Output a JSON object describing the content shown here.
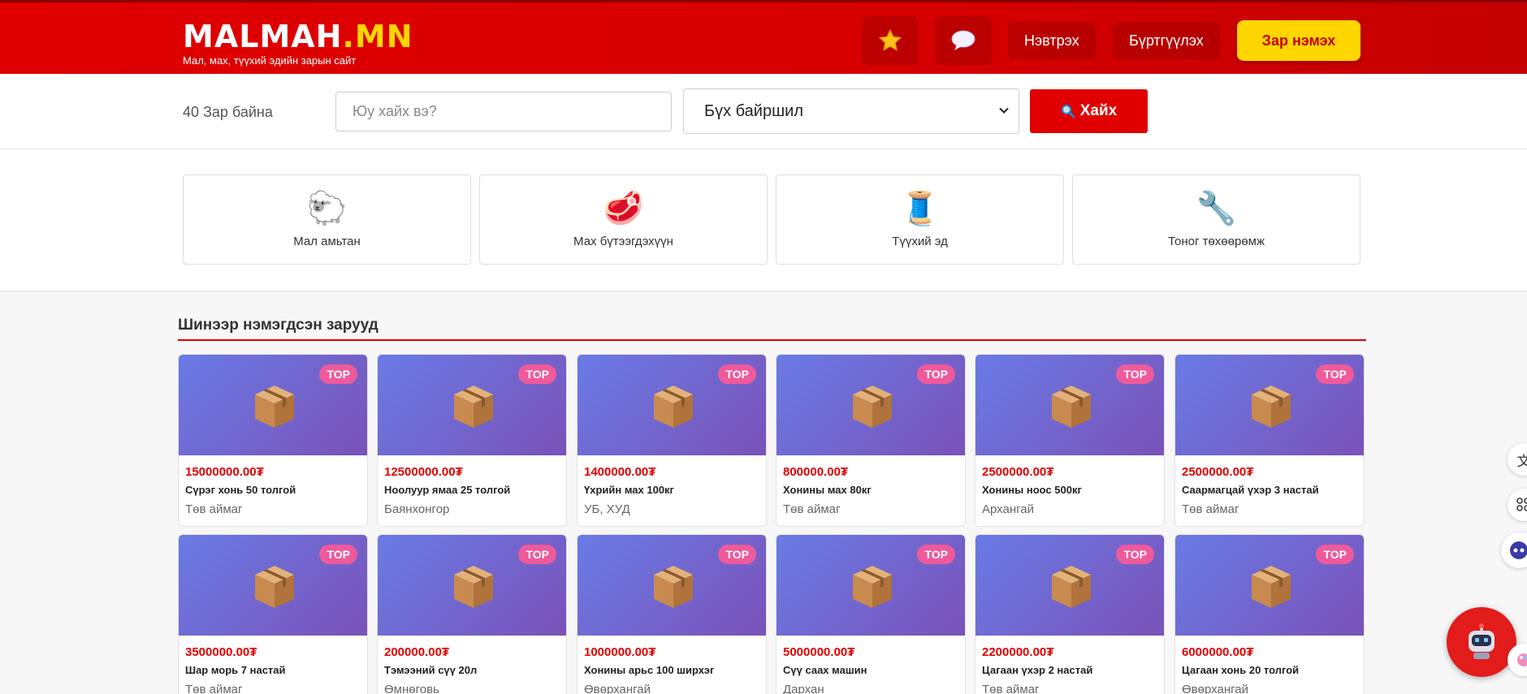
{
  "header": {
    "logo_main": "MALMAH",
    "logo_tld": ".MN",
    "tagline": "Мал, мах, түүхий эдийн зарын сайт",
    "favorites_icon": "star-icon",
    "messages_icon": "chat-bubble-icon",
    "login_label": "Нэвтрэх",
    "register_label": "Бүртгүүлэх",
    "add_ad_label": "Зар нэмэх",
    "colors": {
      "brand_red": "#e00000",
      "accent_yellow": "#ffd600"
    }
  },
  "search": {
    "ad_count": "40 Зар байна",
    "placeholder": "Юу хайх вэ?",
    "location_selected": "Бүх байршил",
    "button_label": "Хайх",
    "button_icon": "magnifier-icon"
  },
  "categories": [
    {
      "label": "Мал амьтан",
      "icon": "sheep-icon",
      "glyph": "🐑"
    },
    {
      "label": "Мах бүтээгдэхүүн",
      "icon": "meat-icon",
      "glyph": "🥩"
    },
    {
      "label": "Түүхий эд",
      "icon": "thread-spool-icon",
      "glyph": "🧵"
    },
    {
      "label": "Тоног төхөөрөмж",
      "icon": "wrench-icon",
      "glyph": "🔧"
    }
  ],
  "listings": {
    "section_title": "Шинээр нэмэгдсэн зарууд",
    "badge": "TOP",
    "items": [
      {
        "price": "15000000.00₮",
        "title": "Сүрэг хонь 50 толгой",
        "location": "Төв аймаг"
      },
      {
        "price": "12500000.00₮",
        "title": "Ноолуур ямаа 25 толгой",
        "location": "Баянхонгор"
      },
      {
        "price": "1400000.00₮",
        "title": "Үхрийн мах 100кг",
        "location": "УБ, ХУД"
      },
      {
        "price": "800000.00₮",
        "title": "Хонины мах 80кг",
        "location": "Төв аймаг"
      },
      {
        "price": "2500000.00₮",
        "title": "Хонины ноос 500кг",
        "location": "Архангай"
      },
      {
        "price": "2500000.00₮",
        "title": "Саармагцай үхэр 3 настай",
        "location": "Төв аймаг"
      },
      {
        "price": "3500000.00₮",
        "title": "Шар морь 7 настай",
        "location": "Төв аймаг"
      },
      {
        "price": "200000.00₮",
        "title": "Тэмээний сүү 20л",
        "location": "Өмнөговь"
      },
      {
        "price": "1000000.00₮",
        "title": "Хонины арьс 100 ширхэг",
        "location": "Өвөрхангай"
      },
      {
        "price": "5000000.00₮",
        "title": "Сүү саах машин",
        "location": "Дархан"
      },
      {
        "price": "2200000.00₮",
        "title": "Цагаан үхэр 2 настай",
        "location": "Төв аймаг"
      },
      {
        "price": "6000000.00₮",
        "title": "Цагаан хонь 20 толгой",
        "location": "Өвөрхангай"
      }
    ]
  },
  "floating": {
    "translate_icon": "translate-icon",
    "apps_icon": "apps-grid-icon",
    "assistant_icon": "assistant-face-icon",
    "chatbot_icon": "robot-icon"
  }
}
